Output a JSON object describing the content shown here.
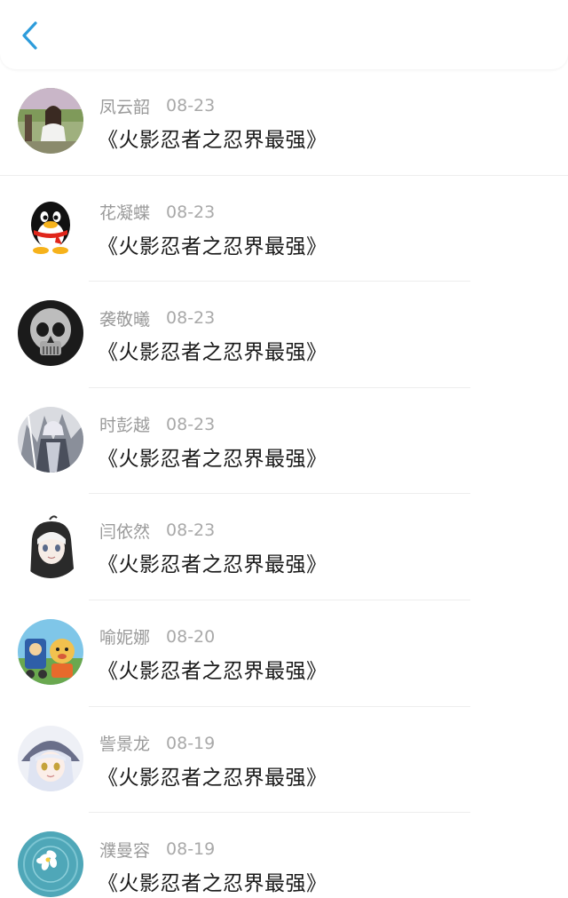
{
  "header": {
    "back_icon": "chevron-left-icon",
    "accent_color": "#2d9cdb"
  },
  "items": [
    {
      "name": "凤云韶",
      "date": "08-23",
      "content": "《火影忍者之忍界最强》",
      "avatar_icon": "photo-girl-avatar"
    },
    {
      "name": "花凝蝶",
      "date": "08-23",
      "content": "《火影忍者之忍界最强》",
      "avatar_icon": "qq-penguin-avatar"
    },
    {
      "name": "袭敬曦",
      "date": "08-23",
      "content": "《火影忍者之忍界最强》",
      "avatar_icon": "skull-avatar"
    },
    {
      "name": "时彭越",
      "date": "08-23",
      "content": "《火影忍者之忍界最强》",
      "avatar_icon": "anime-character-avatar"
    },
    {
      "name": "闫依然",
      "date": "08-23",
      "content": "《火影忍者之忍界最强》",
      "avatar_icon": "anime-girl-avatar"
    },
    {
      "name": "喻妮娜",
      "date": "08-20",
      "content": "《火影忍者之忍界最强》",
      "avatar_icon": "cartoon-avatar"
    },
    {
      "name": "訾景龙",
      "date": "08-19",
      "content": "《火影忍者之忍界最强》",
      "avatar_icon": "anime-witch-avatar"
    },
    {
      "name": "濮曼容",
      "date": "08-19",
      "content": "《火影忍者之忍界最强》",
      "avatar_icon": "flower-water-avatar"
    }
  ]
}
